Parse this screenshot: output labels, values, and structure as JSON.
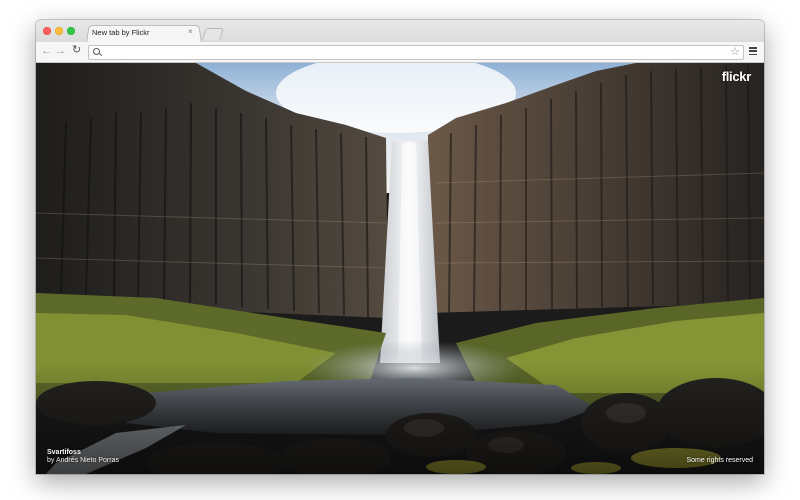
{
  "tab": {
    "title": "New tab by Flickr",
    "close_glyph": "×"
  },
  "toolbar": {
    "back_glyph": "←",
    "forward_glyph": "→",
    "reload_glyph": "↻",
    "omnibox_value": "",
    "star_glyph": "☆"
  },
  "photo": {
    "title": "Svartifoss",
    "author": "by Andrés Nieto Porras",
    "rights": "Some rights reserved"
  },
  "brand": {
    "logo": "flickr"
  },
  "icons": [
    "close-icon",
    "back-arrow-icon",
    "forward-arrow-icon",
    "reload-icon",
    "search-icon",
    "star-icon",
    "menu-icon"
  ],
  "colors": {
    "close_button": "#fc605c",
    "minimize_button": "#fdbc40",
    "zoom_button": "#34c84a"
  }
}
